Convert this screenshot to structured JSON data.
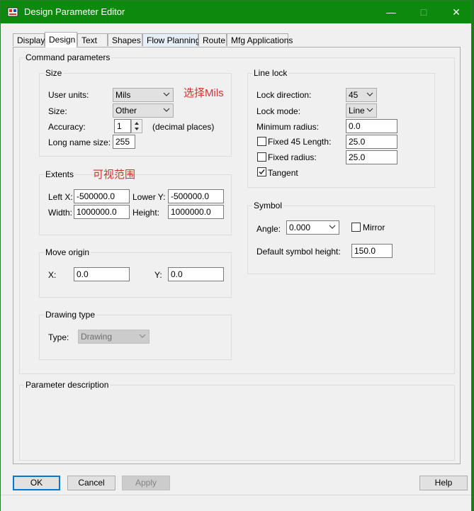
{
  "window": {
    "title": "Design Parameter Editor",
    "minimize": "—",
    "maximize": "□",
    "close": "✕"
  },
  "tabs": [
    "Display",
    "Design",
    "Text",
    "Shapes",
    "Flow Planning",
    "Route",
    "Mfg Applications"
  ],
  "command_parameters_label": "Command parameters",
  "size": {
    "label": "Size",
    "user_units_label": "User units:",
    "user_units_value": "Mils",
    "size_label": "Size:",
    "size_value": "Other",
    "accuracy_label": "Accuracy:",
    "accuracy_value": "1",
    "accuracy_suffix": "(decimal places)",
    "long_name_label": "Long name size:",
    "long_name_value": "255",
    "annotation": "选择Mils"
  },
  "extents": {
    "label": "Extents",
    "left_x_label": "Left X:",
    "left_x_value": "-500000.0",
    "lower_y_label": "Lower Y:",
    "lower_y_value": "-500000.0",
    "width_label": "Width:",
    "width_value": "1000000.0",
    "height_label": "Height:",
    "height_value": "1000000.0",
    "annotation": "可视范围"
  },
  "move_origin": {
    "label": "Move origin",
    "x_label": "X:",
    "x_value": "0.0",
    "y_label": "Y:",
    "y_value": "0.0"
  },
  "drawing_type": {
    "label": "Drawing type",
    "type_label": "Type:",
    "type_value": "Drawing"
  },
  "line_lock": {
    "label": "Line lock",
    "lock_direction_label": "Lock direction:",
    "lock_direction_value": "45",
    "lock_mode_label": "Lock mode:",
    "lock_mode_value": "Line",
    "min_radius_label": "Minimum radius:",
    "min_radius_value": "0.0",
    "fixed45_label": "Fixed 45 Length:",
    "fixed45_value": "25.0",
    "fixed45_checked": false,
    "fixed_radius_label": "Fixed radius:",
    "fixed_radius_value": "25.0",
    "fixed_radius_checked": false,
    "tangent_label": "Tangent",
    "tangent_checked": true
  },
  "symbol": {
    "label": "Symbol",
    "angle_label": "Angle:",
    "angle_value": "0.000",
    "mirror_label": "Mirror",
    "mirror_checked": false,
    "default_height_label": "Default symbol height:",
    "default_height_value": "150.0"
  },
  "parameter_description_label": "Parameter description",
  "buttons": {
    "ok": "OK",
    "cancel": "Cancel",
    "apply": "Apply",
    "help": "Help"
  },
  "colors": {
    "titlebar": "#0d8a0d",
    "annotation": "#d4332b",
    "accent": "#0078d7"
  }
}
